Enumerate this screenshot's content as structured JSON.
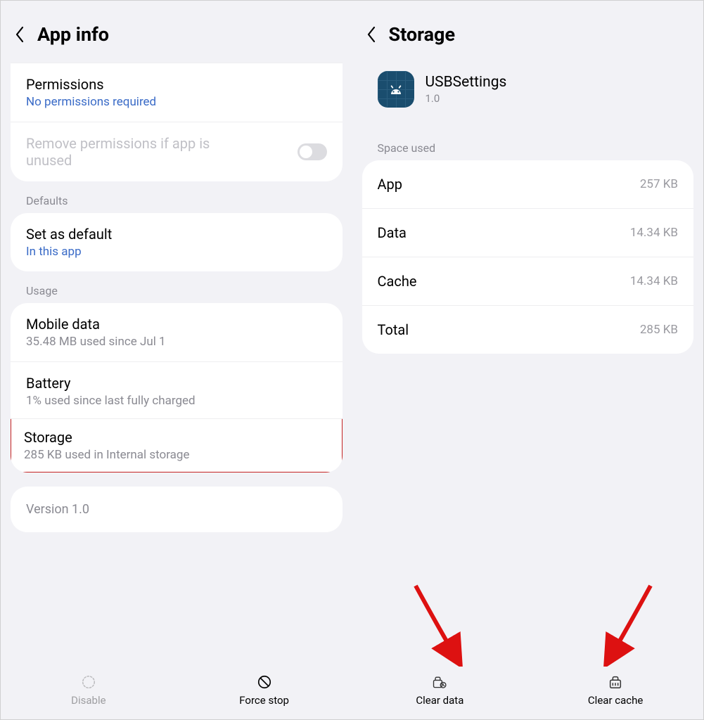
{
  "left": {
    "title": "App info",
    "permissions": {
      "title": "Permissions",
      "subtitle": "No permissions required"
    },
    "remove_perms": {
      "title": "Remove permissions if app is unused"
    },
    "sections": {
      "defaults": "Defaults",
      "usage": "Usage"
    },
    "set_default": {
      "title": "Set as default",
      "subtitle": "In this app"
    },
    "mobile_data": {
      "title": "Mobile data",
      "subtitle": "35.48 MB used since Jul 1"
    },
    "battery": {
      "title": "Battery",
      "subtitle": "1% used since last fully charged"
    },
    "storage": {
      "title": "Storage",
      "subtitle": "285 KB used in Internal storage"
    },
    "version": "Version 1.0",
    "buttons": {
      "disable": "Disable",
      "force_stop": "Force stop"
    }
  },
  "right": {
    "title": "Storage",
    "app": {
      "name": "USBSettings",
      "version": "1.0"
    },
    "section": "Space used",
    "rows": {
      "app": {
        "label": "App",
        "value": "257 KB"
      },
      "data": {
        "label": "Data",
        "value": "14.34 KB"
      },
      "cache": {
        "label": "Cache",
        "value": "14.34 KB"
      },
      "total": {
        "label": "Total",
        "value": "285 KB"
      }
    },
    "buttons": {
      "clear_data": "Clear data",
      "clear_cache": "Clear cache"
    }
  }
}
